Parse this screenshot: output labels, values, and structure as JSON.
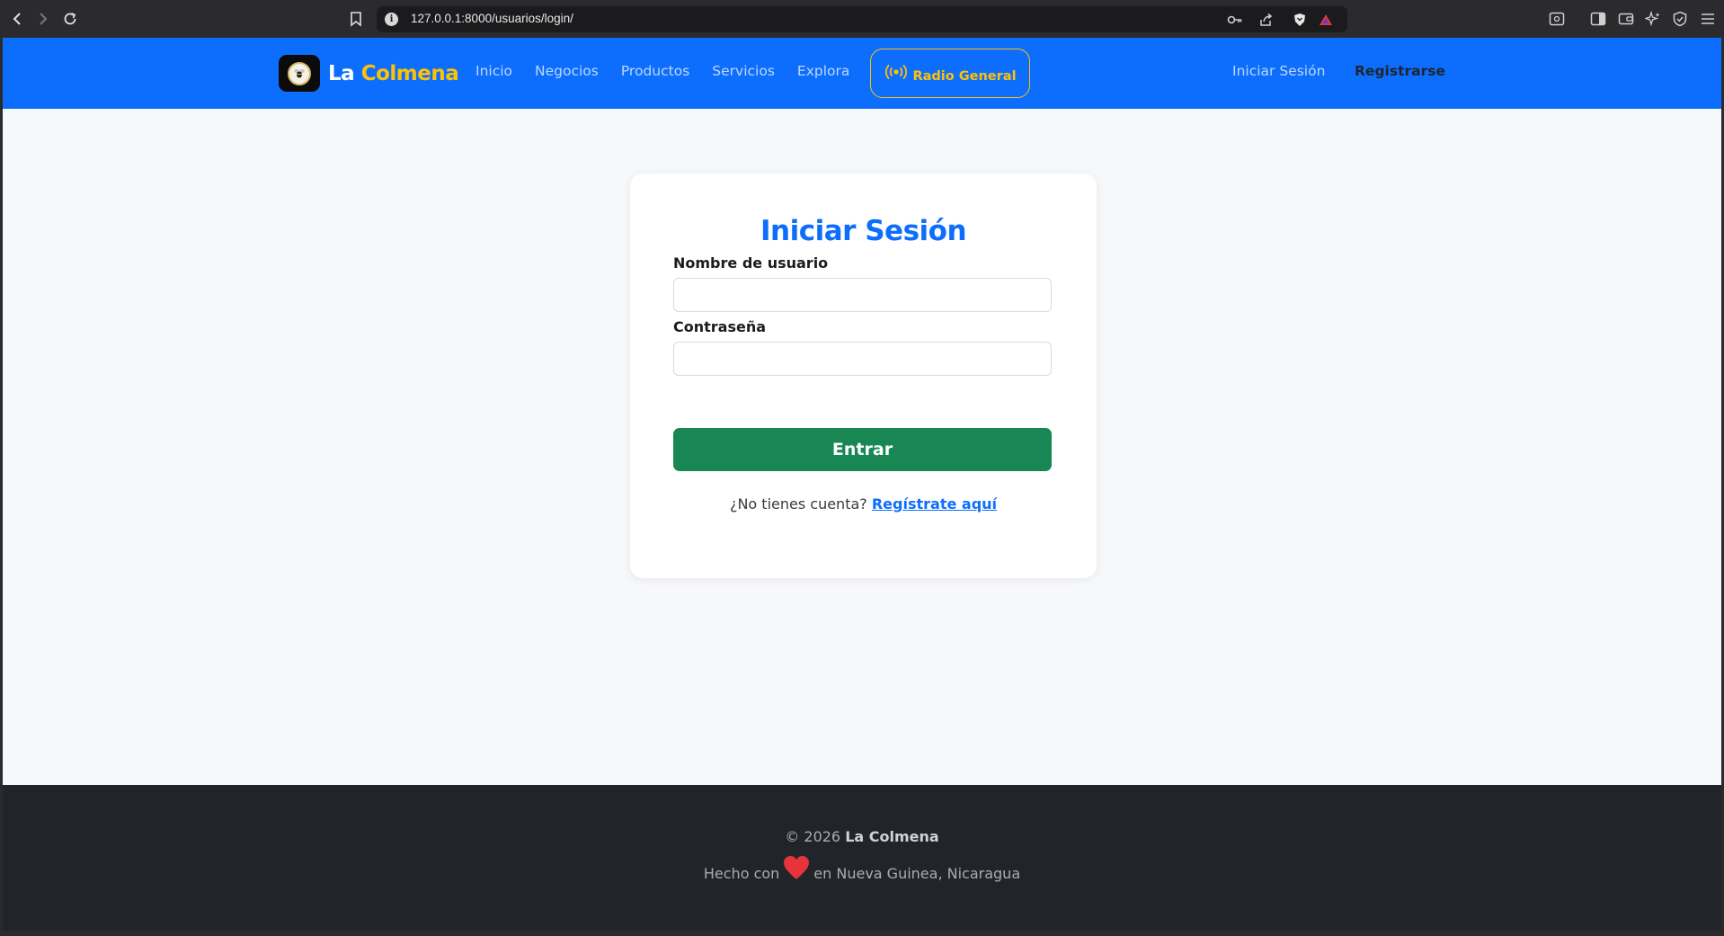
{
  "browser": {
    "url": "127.0.0.1:8000/usuarios/login/",
    "icons": {
      "back": "back-arrow-icon",
      "forward": "forward-arrow-icon",
      "reload": "reload-icon",
      "bookmark": "bookmark-icon",
      "site_info": "info-icon",
      "password": "key-icon",
      "share": "share-icon",
      "shield": "brave-shield-icon",
      "rewards": "brave-rewards-icon",
      "reader": "reader-mode-icon",
      "sidebar": "sidebar-icon",
      "wallet": "wallet-icon",
      "leo": "leo-ai-icon",
      "vpn": "vpn-icon",
      "menu": "menu-icon"
    }
  },
  "navbar": {
    "brand_first": "La",
    "brand_second": "Colmena",
    "links": [
      "Inicio",
      "Negocios",
      "Productos",
      "Servicios",
      "Explora"
    ],
    "radio_label": "Radio General",
    "login_label": "Iniciar Sesión",
    "register_label": "Registrarse"
  },
  "login_form": {
    "title": "Iniciar Sesión",
    "username_label": "Nombre de usuario",
    "username_value": "",
    "password_label": "Contraseña",
    "password_value": "",
    "submit_label": "Entrar",
    "signup_prompt": "¿No tienes cuenta?",
    "signup_link": "Regístrate aquí"
  },
  "footer": {
    "copyright": "© 2026",
    "brand": "La Colmena",
    "made_with": "Hecho con",
    "location": "en Nueva Guinea, Nicaragua"
  },
  "colors": {
    "primary": "#0d6efd",
    "accent": "#ffc107",
    "success": "#198754",
    "footer_bg": "#212529",
    "heart": "#e8333d"
  }
}
